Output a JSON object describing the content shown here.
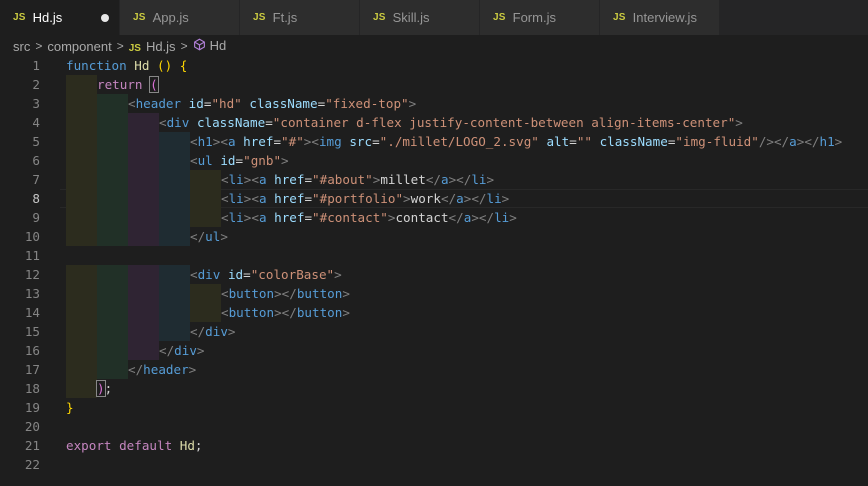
{
  "tabs": [
    {
      "label": "Hd.js",
      "active": true,
      "dirty": true
    },
    {
      "label": "App.js",
      "active": false,
      "dirty": false
    },
    {
      "label": "Ft.js",
      "active": false,
      "dirty": false
    },
    {
      "label": "Skill.js",
      "active": false,
      "dirty": false
    },
    {
      "label": "Form.js",
      "active": false,
      "dirty": false
    },
    {
      "label": "Interview.js",
      "active": false,
      "dirty": false
    }
  ],
  "tab_badge": "JS",
  "breadcrumb": {
    "parts": [
      "src",
      "component",
      "Hd.js",
      "Hd"
    ],
    "separator": ">"
  },
  "editor": {
    "current_line": 8,
    "lines": [
      {
        "n": "1",
        "tokens": [
          [
            "kw",
            "function "
          ],
          [
            "fn",
            "Hd "
          ],
          [
            "brace",
            "() {"
          ]
        ]
      },
      {
        "n": "2",
        "tokens": [
          [
            "ctl",
            "return "
          ],
          [
            "paren",
            "("
          ]
        ]
      },
      {
        "n": "3",
        "tokens": [
          [
            "punct",
            "<"
          ],
          [
            "tag",
            "header "
          ],
          [
            "attr",
            "id"
          ],
          [
            "txt",
            "="
          ],
          [
            "str",
            "\"hd\" "
          ],
          [
            "attr",
            "className"
          ],
          [
            "txt",
            "="
          ],
          [
            "str",
            "\"fixed-top\""
          ],
          [
            "punct",
            ">"
          ]
        ]
      },
      {
        "n": "4",
        "tokens": [
          [
            "punct",
            "<"
          ],
          [
            "tag",
            "div "
          ],
          [
            "attr",
            "className"
          ],
          [
            "txt",
            "="
          ],
          [
            "str",
            "\"container d-flex justify-content-between align-items-center\""
          ],
          [
            "punct",
            ">"
          ]
        ]
      },
      {
        "n": "5",
        "tokens": [
          [
            "punct",
            "<"
          ],
          [
            "tag",
            "h1"
          ],
          [
            "punct",
            "><"
          ],
          [
            "tag",
            "a "
          ],
          [
            "attr",
            "href"
          ],
          [
            "txt",
            "="
          ],
          [
            "str",
            "\"#\""
          ],
          [
            "punct",
            "><"
          ],
          [
            "tag",
            "img "
          ],
          [
            "attr",
            "src"
          ],
          [
            "txt",
            "="
          ],
          [
            "str",
            "\"./millet/LOGO_2.svg\" "
          ],
          [
            "attr",
            "alt"
          ],
          [
            "txt",
            "="
          ],
          [
            "str",
            "\"\" "
          ],
          [
            "attr",
            "className"
          ],
          [
            "txt",
            "="
          ],
          [
            "str",
            "\"img-fluid\""
          ],
          [
            "punct",
            "/></"
          ],
          [
            "tag",
            "a"
          ],
          [
            "punct",
            "></"
          ],
          [
            "tag",
            "h1"
          ],
          [
            "punct",
            ">"
          ]
        ]
      },
      {
        "n": "6",
        "tokens": [
          [
            "punct",
            "<"
          ],
          [
            "tag",
            "ul "
          ],
          [
            "attr",
            "id"
          ],
          [
            "txt",
            "="
          ],
          [
            "str",
            "\"gnb\""
          ],
          [
            "punct",
            ">"
          ]
        ]
      },
      {
        "n": "7",
        "tokens": [
          [
            "punct",
            "<"
          ],
          [
            "tag",
            "li"
          ],
          [
            "punct",
            "><"
          ],
          [
            "tag",
            "a "
          ],
          [
            "attr",
            "href"
          ],
          [
            "txt",
            "="
          ],
          [
            "str",
            "\"#about\""
          ],
          [
            "punct",
            ">"
          ],
          [
            "txt",
            "millet"
          ],
          [
            "punct",
            "</"
          ],
          [
            "tag",
            "a"
          ],
          [
            "punct",
            "></"
          ],
          [
            "tag",
            "li"
          ],
          [
            "punct",
            ">"
          ]
        ]
      },
      {
        "n": "8",
        "tokens": [
          [
            "punct",
            "<"
          ],
          [
            "tag",
            "li"
          ],
          [
            "punct",
            "><"
          ],
          [
            "tag",
            "a "
          ],
          [
            "attr",
            "href"
          ],
          [
            "txt",
            "="
          ],
          [
            "str",
            "\"#portfolio\""
          ],
          [
            "punct",
            ">"
          ],
          [
            "txt",
            "work"
          ],
          [
            "punct",
            "</"
          ],
          [
            "tag",
            "a"
          ],
          [
            "punct",
            "></"
          ],
          [
            "tag",
            "li"
          ],
          [
            "punct",
            ">"
          ]
        ]
      },
      {
        "n": "9",
        "tokens": [
          [
            "punct",
            "<"
          ],
          [
            "tag",
            "li"
          ],
          [
            "punct",
            "><"
          ],
          [
            "tag",
            "a "
          ],
          [
            "attr",
            "href"
          ],
          [
            "txt",
            "="
          ],
          [
            "str",
            "\"#contact\""
          ],
          [
            "punct",
            ">"
          ],
          [
            "txt",
            "contact"
          ],
          [
            "punct",
            "</"
          ],
          [
            "tag",
            "a"
          ],
          [
            "punct",
            "></"
          ],
          [
            "tag",
            "li"
          ],
          [
            "punct",
            ">"
          ]
        ]
      },
      {
        "n": "10",
        "tokens": [
          [
            "punct",
            "</"
          ],
          [
            "tag",
            "ul"
          ],
          [
            "punct",
            ">"
          ]
        ]
      },
      {
        "n": "11",
        "tokens": []
      },
      {
        "n": "12",
        "tokens": [
          [
            "punct",
            "<"
          ],
          [
            "tag",
            "div "
          ],
          [
            "attr",
            "id"
          ],
          [
            "txt",
            "="
          ],
          [
            "str",
            "\"colorBase\""
          ],
          [
            "punct",
            ">"
          ]
        ]
      },
      {
        "n": "13",
        "tokens": [
          [
            "punct",
            "<"
          ],
          [
            "tag",
            "button"
          ],
          [
            "punct",
            "></"
          ],
          [
            "tag",
            "button"
          ],
          [
            "punct",
            ">"
          ]
        ]
      },
      {
        "n": "14",
        "tokens": [
          [
            "punct",
            "<"
          ],
          [
            "tag",
            "button"
          ],
          [
            "punct",
            "></"
          ],
          [
            "tag",
            "button"
          ],
          [
            "punct",
            ">"
          ]
        ]
      },
      {
        "n": "15",
        "tokens": [
          [
            "punct",
            "</"
          ],
          [
            "tag",
            "div"
          ],
          [
            "punct",
            ">"
          ]
        ]
      },
      {
        "n": "16",
        "tokens": [
          [
            "punct",
            "</"
          ],
          [
            "tag",
            "div"
          ],
          [
            "punct",
            ">"
          ]
        ]
      },
      {
        "n": "17",
        "tokens": [
          [
            "punct",
            "</"
          ],
          [
            "tag",
            "header"
          ],
          [
            "punct",
            ">"
          ]
        ]
      },
      {
        "n": "18",
        "tokens": [
          [
            "paren",
            ")"
          ],
          [
            "txt",
            ";"
          ]
        ]
      },
      {
        "n": "19",
        "tokens": [
          [
            "brace",
            "}"
          ]
        ]
      },
      {
        "n": "20",
        "tokens": []
      },
      {
        "n": "21",
        "tokens": [
          [
            "ctl",
            "export "
          ],
          [
            "ctl",
            "default "
          ],
          [
            "fn",
            "Hd"
          ],
          [
            "txt",
            ";"
          ]
        ]
      },
      {
        "n": "22",
        "tokens": []
      }
    ]
  }
}
